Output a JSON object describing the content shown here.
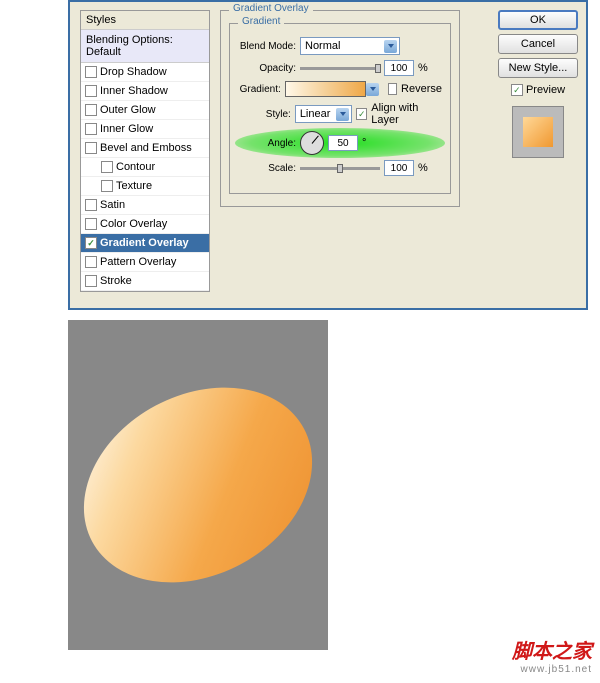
{
  "dialog": {
    "styles_header": "Styles",
    "blending_default": "Blending Options: Default",
    "items": [
      {
        "label": "Drop Shadow",
        "checked": false,
        "indent": false,
        "active": false
      },
      {
        "label": "Inner Shadow",
        "checked": false,
        "indent": false,
        "active": false
      },
      {
        "label": "Outer Glow",
        "checked": false,
        "indent": false,
        "active": false
      },
      {
        "label": "Inner Glow",
        "checked": false,
        "indent": false,
        "active": false
      },
      {
        "label": "Bevel and Emboss",
        "checked": false,
        "indent": false,
        "active": false
      },
      {
        "label": "Contour",
        "checked": false,
        "indent": true,
        "active": false
      },
      {
        "label": "Texture",
        "checked": false,
        "indent": true,
        "active": false
      },
      {
        "label": "Satin",
        "checked": false,
        "indent": false,
        "active": false
      },
      {
        "label": "Color Overlay",
        "checked": false,
        "indent": false,
        "active": false
      },
      {
        "label": "Gradient Overlay",
        "checked": true,
        "indent": false,
        "active": true
      },
      {
        "label": "Pattern Overlay",
        "checked": false,
        "indent": false,
        "active": false
      },
      {
        "label": "Stroke",
        "checked": false,
        "indent": false,
        "active": false
      }
    ]
  },
  "settings": {
    "title": "Gradient Overlay",
    "subtitle": "Gradient",
    "blend_mode_label": "Blend Mode:",
    "blend_mode_value": "Normal",
    "opacity_label": "Opacity:",
    "opacity_value": "100",
    "opacity_suffix": "%",
    "gradient_label": "Gradient:",
    "reverse_label": "Reverse",
    "style_label": "Style:",
    "style_value": "Linear",
    "align_label": "Align with Layer",
    "angle_label": "Angle:",
    "angle_value": "50",
    "angle_suffix": "°",
    "scale_label": "Scale:",
    "scale_value": "100",
    "scale_suffix": "%"
  },
  "buttons": {
    "ok": "OK",
    "cancel": "Cancel",
    "new_style": "New Style...",
    "preview": "Preview"
  },
  "watermark": {
    "cn": "脚本之家",
    "en": "www.jb51.net"
  }
}
